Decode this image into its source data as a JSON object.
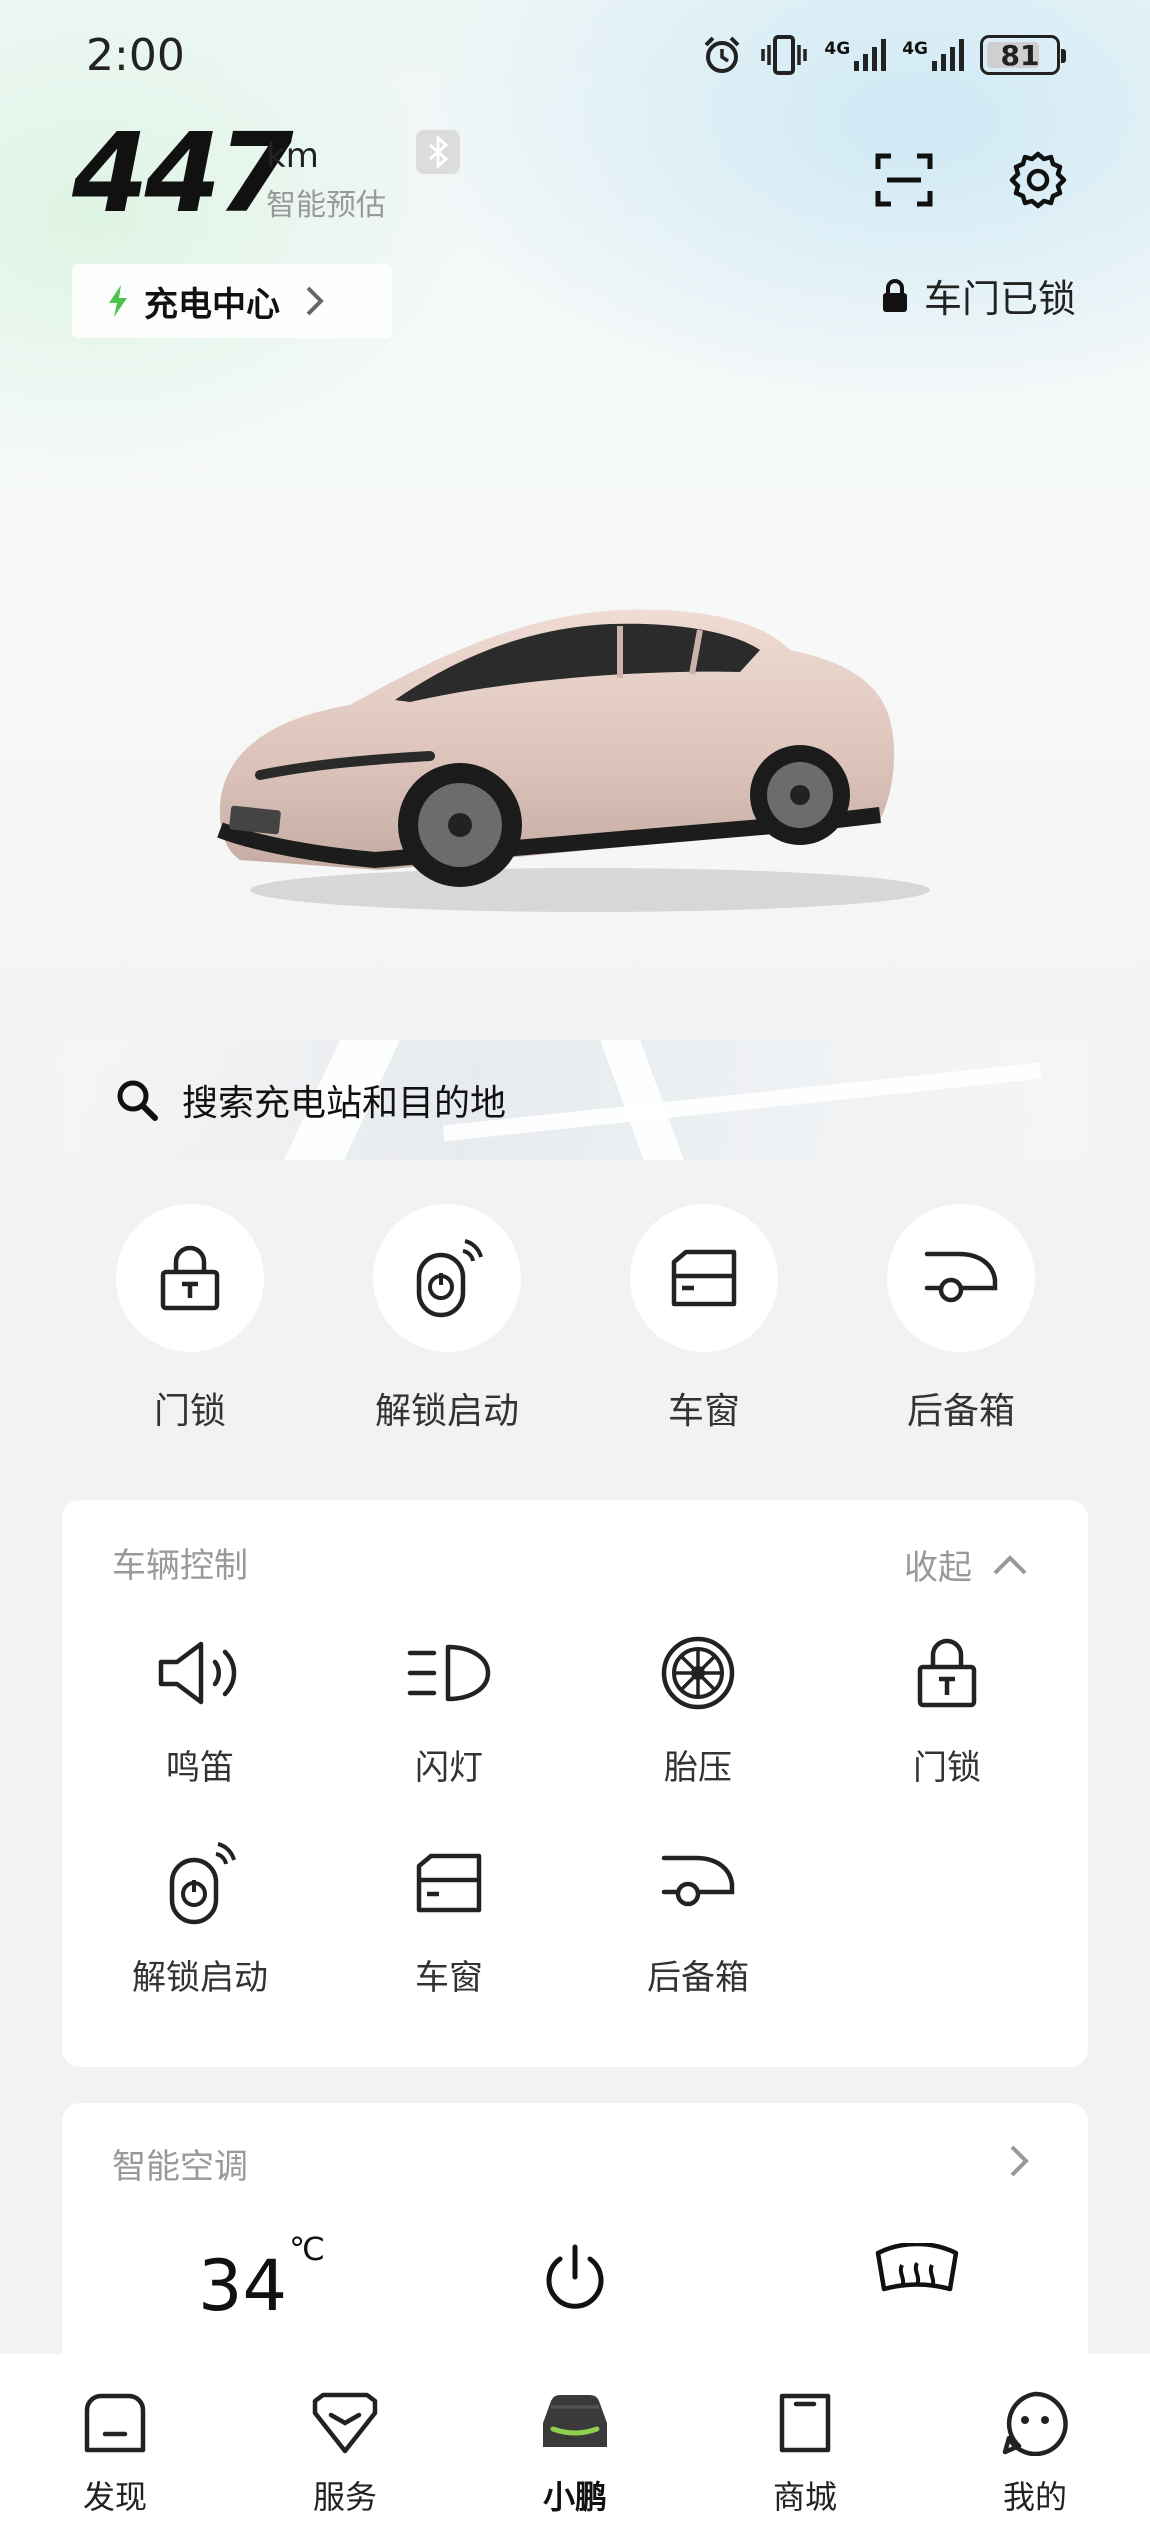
{
  "status_bar": {
    "time": "2:00",
    "network_1": "4G",
    "network_2": "4G",
    "battery": "81",
    "battery_level_percent": 81
  },
  "range": {
    "value": "447",
    "unit": "km",
    "note": "智能预估"
  },
  "charging_center": {
    "label": "充电中心",
    "icon": "lightning-icon",
    "accent_color": "#4cc24f"
  },
  "door_status": {
    "label": "车门已锁",
    "icon": "lock-icon"
  },
  "search": {
    "placeholder": "搜索充电站和目的地"
  },
  "quick_actions": [
    {
      "label": "门锁",
      "icon": "padlock-icon"
    },
    {
      "label": "解锁启动",
      "icon": "key-fob-icon"
    },
    {
      "label": "车窗",
      "icon": "window-icon"
    },
    {
      "label": "后备箱",
      "icon": "trunk-icon"
    }
  ],
  "vehicle_control": {
    "title": "车辆控制",
    "collapse_label": "收起",
    "items": [
      {
        "label": "鸣笛",
        "icon": "horn-icon"
      },
      {
        "label": "闪灯",
        "icon": "headlight-icon"
      },
      {
        "label": "胎压",
        "icon": "tire-icon"
      },
      {
        "label": "门锁",
        "icon": "padlock-icon"
      },
      {
        "label": "解锁启动",
        "icon": "key-fob-icon"
      },
      {
        "label": "车窗",
        "icon": "window-icon"
      },
      {
        "label": "后备箱",
        "icon": "trunk-icon"
      }
    ]
  },
  "climate": {
    "title": "智能空调",
    "temperature": "34",
    "temp_unit": "℃"
  },
  "bottom_nav": {
    "active_color": "#8fd14f",
    "items": [
      {
        "label": "发现",
        "icon": "discover-icon"
      },
      {
        "label": "服务",
        "icon": "service-icon"
      },
      {
        "label": "小鹏",
        "icon": "car-icon",
        "active": true
      },
      {
        "label": "商城",
        "icon": "shop-icon"
      },
      {
        "label": "我的",
        "icon": "profile-icon"
      }
    ]
  }
}
